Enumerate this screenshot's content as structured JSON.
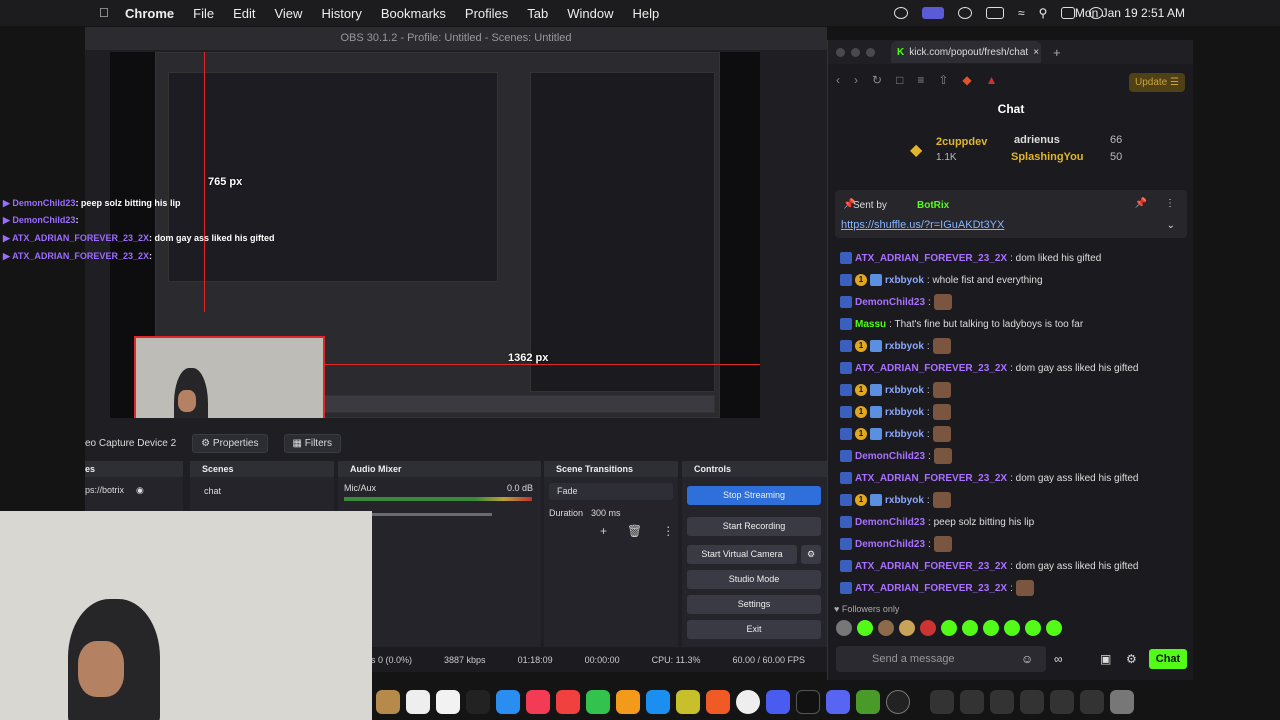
{
  "menubar": {
    "app": "Chrome",
    "items": [
      "File",
      "Edit",
      "View",
      "History",
      "Bookmarks",
      "Profiles",
      "Tab",
      "Window",
      "Help"
    ],
    "clock": "Mon Jan 19  2:51 AM"
  },
  "obs": {
    "title": "OBS 30.1.2 - Profile: Untitled - Scenes: Untitled",
    "px_label_1": "765 px",
    "px_label_2": "1362 px",
    "source_name": "eo Capture Device 2",
    "properties": "Properties",
    "filters": "Filters",
    "sources_header": "es",
    "sources_item": "ps://botrix",
    "scenes_header": "Scenes",
    "scene_item": "chat",
    "mixer_header": "Audio Mixer",
    "mixer_channel": "Mic/Aux",
    "mixer_db": "0.0 dB",
    "mixer_scale": [
      "-60",
      "-55",
      "-50",
      "-45",
      "-40",
      "-35",
      "-30",
      "-25",
      "-20",
      "-15",
      "-10",
      "-5",
      "0"
    ],
    "transitions_header": "Scene Transitions",
    "transition": "Fade",
    "duration_label": "Duration",
    "duration": "300 ms",
    "controls_header": "Controls",
    "controls": [
      "Stop Streaming",
      "Start Recording",
      "Start Virtual Camera",
      "Studio Mode",
      "Settings",
      "Exit"
    ],
    "status": {
      "dropped": "s 0 (0.0%)",
      "kbps": "3887 kbps",
      "stream_time": "01:18:09",
      "rec_time": "00:00:00",
      "cpu": "CPU: 11.3%",
      "fps": "60.00 / 60.00 FPS"
    }
  },
  "overlay_chat": [
    {
      "user": "DemonChild23",
      "msg": ": peep solz bitting his lip"
    },
    {
      "user": "DemonChild23",
      "msg": ":"
    },
    {
      "user": "ATX_ADRIAN_FOREVER_23_2X",
      "msg": ": dom gay ass liked his gifted"
    },
    {
      "user": "ATX_ADRIAN_FOREVER_23_2X",
      "msg": ":"
    }
  ],
  "browser": {
    "tab_title": "kick.com/popout/fresh/chat",
    "update": "Update",
    "chat_title": "Chat",
    "gifters": [
      {
        "name": "2cuppdev",
        "count": "1.1K"
      },
      {
        "name": "adrienus",
        "count": "66"
      },
      {
        "name": "SplashingYou",
        "count": "50"
      }
    ],
    "pinned_by": "Sent by",
    "pinned_user": "BotRix",
    "pinned_link": "https://shuffle.us/?r=IGuAKDt3YX",
    "messages": [
      {
        "user": "ATX_ADRIAN_FOREVER_23_2X",
        "text": ": dom liked his gifted",
        "color": "#a970ff"
      },
      {
        "user": "rxbbyok",
        "text": ": whole fist and everything",
        "color": "#8aa8ff"
      },
      {
        "user": "DemonChild23",
        "text": ":",
        "color": "#a970ff"
      },
      {
        "user": "Massu",
        "text": ": That's fine but talking to ladyboys is too far",
        "color": "#53fc18"
      },
      {
        "user": "rxbbyok",
        "text": ":",
        "color": "#8aa8ff"
      },
      {
        "user": "ATX_ADRIAN_FOREVER_23_2X",
        "text": ": dom gay ass liked his gifted",
        "color": "#a970ff"
      },
      {
        "user": "rxbbyok",
        "text": ":",
        "color": "#8aa8ff"
      },
      {
        "user": "rxbbyok",
        "text": ":",
        "color": "#8aa8ff"
      },
      {
        "user": "rxbbyok",
        "text": ":",
        "color": "#8aa8ff"
      },
      {
        "user": "DemonChild23",
        "text": ":",
        "color": "#a970ff"
      },
      {
        "user": "ATX_ADRIAN_FOREVER_23_2X",
        "text": ": dom gay ass liked his gifted",
        "color": "#a970ff"
      },
      {
        "user": "rxbbyok",
        "text": ":",
        "color": "#8aa8ff"
      },
      {
        "user": "DemonChild23",
        "text": ": peep solz bitting his lip",
        "color": "#a970ff"
      },
      {
        "user": "DemonChild23",
        "text": ":",
        "color": "#a970ff"
      },
      {
        "user": "ATX_ADRIAN_FOREVER_23_2X",
        "text": ": dom gay ass liked his gifted",
        "color": "#a970ff"
      },
      {
        "user": "ATX_ADRIAN_FOREVER_23_2X",
        "text": ":",
        "color": "#a970ff"
      }
    ],
    "followers_only": "Followers only",
    "send_placeholder": "Send a message",
    "chat_button": "Chat"
  }
}
